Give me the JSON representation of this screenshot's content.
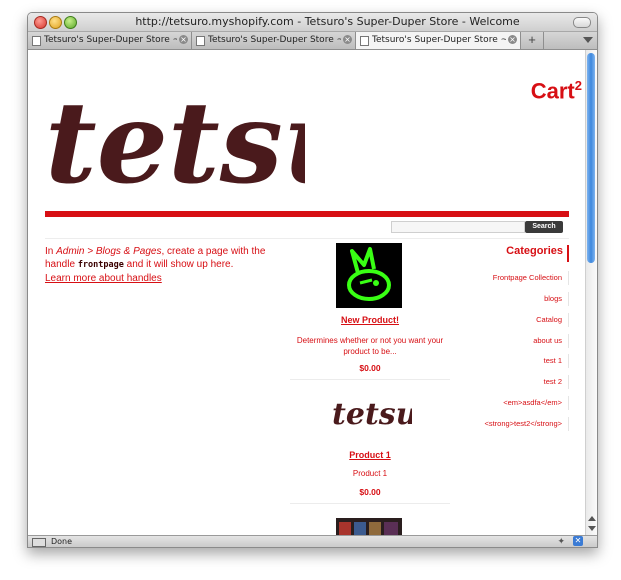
{
  "window": {
    "title": "http://tetsuro.myshopify.com - Tetsuro's Super-Duper Store - Welcome"
  },
  "tabs": [
    {
      "label": "Tetsuro's Super-Duper Store ~",
      "active": false
    },
    {
      "label": "Tetsuro's Super-Duper Store ~",
      "active": false
    },
    {
      "label": "Tetsuro's Super-Duper Store ~",
      "active": true
    }
  ],
  "newtab_label": "+",
  "status": {
    "text": "Done"
  },
  "page": {
    "logo_text": "tetsu",
    "cart": {
      "label": "Cart",
      "count": "2"
    },
    "search": {
      "button": "Search"
    },
    "intro": {
      "p1": "In ",
      "em1": "Admin > Blogs & Pages",
      "p2": ", create a page with the handle ",
      "code": "frontpage",
      "p3": " and it will show up here.",
      "link": "Learn more about handles"
    },
    "products": [
      {
        "title": "New Product!",
        "description": "Determines whether or not you want your product to be...",
        "price": "$0.00",
        "image": "green-bunny-icon"
      },
      {
        "title": "Product 1",
        "description": "Product 1",
        "price": "$0.00",
        "image": "tetsu-logo-small"
      },
      {
        "title": "",
        "description": "",
        "price": "",
        "image": "shirts-photo"
      }
    ],
    "categories": {
      "title": "Categories",
      "items": [
        "Frontpage Collection",
        "blogs",
        "Catalog",
        "about us",
        "test 1",
        "test 2",
        "<em>asdfa</em>",
        "<strong>test2</strong>"
      ]
    }
  },
  "colors": {
    "brand_red": "#d70f14",
    "logo_brown": "#4a1a1c",
    "bunny_green": "#39ff14"
  }
}
